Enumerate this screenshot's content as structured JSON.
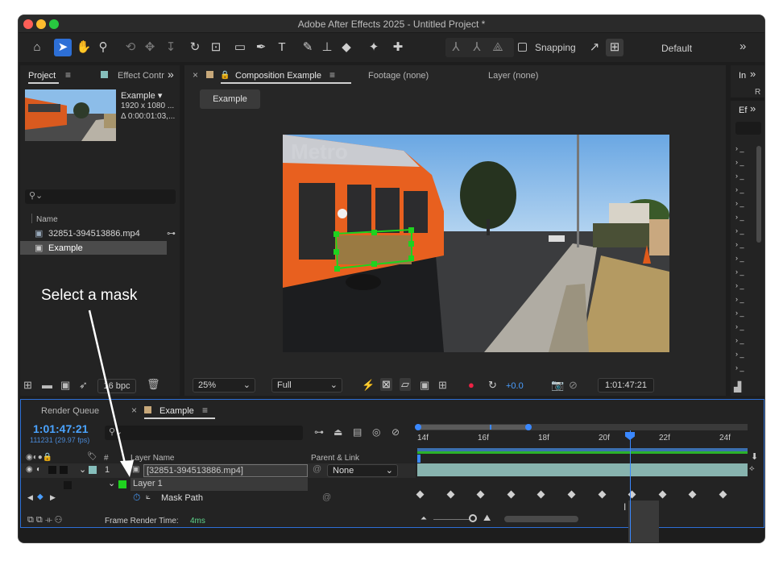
{
  "window": {
    "title": "Adobe After Effects 2025 - Untitled Project *"
  },
  "toolbar": {
    "snapping_label": "Snapping",
    "workspace": "Default",
    "more": "»"
  },
  "project_panel": {
    "tab_project": "Project",
    "tab_effects": "Effect Contr",
    "more": "»",
    "comp_name": "Example ▾",
    "comp_size": "1920 x 1080 ...",
    "comp_duration": "Δ 0:00:01:03,...",
    "search_placeholder": "",
    "col_name": "Name",
    "items": [
      {
        "name": "32851-394513886.mp4"
      },
      {
        "name": "Example"
      }
    ],
    "bpc": "16 bpc"
  },
  "comp_panel": {
    "tab_comp": "Composition Example",
    "tab_footage": "Footage (none)",
    "tab_layer": "Layer (none)",
    "flowchart_btn": "Example",
    "zoom": "25%",
    "resolution": "Full",
    "exposure": "+0.0",
    "timecode": "1:01:47:21"
  },
  "right_panel": {
    "tab_info": "In",
    "tab_effects": "Ef",
    "more": "»",
    "info_row": "R"
  },
  "timeline": {
    "tab_render": "Render Queue",
    "tab_example": "Example",
    "timecode": "1:01:47:21",
    "frames": "111231 (29.97 fps)",
    "col_num": "#",
    "col_layer": "Layer Name",
    "col_parent": "Parent & Link",
    "layer_num": "1",
    "layer_name": "[32851-394513886.mp4]",
    "parent_value": "None",
    "mask_name": "Layer 1",
    "mask_path": "Mask Path",
    "ruler": [
      "14f",
      "16f",
      "18f",
      "20f",
      "22f",
      "24f"
    ],
    "render_time_label": "Frame Render Time:",
    "render_time_value": "4ms"
  },
  "annotation": {
    "text": "Select a mask"
  },
  "colors": {
    "accent": "#2d6fd6",
    "mask": "#1fd21f",
    "timecode": "#4aa3ff",
    "render_time": "#5fd68c"
  }
}
